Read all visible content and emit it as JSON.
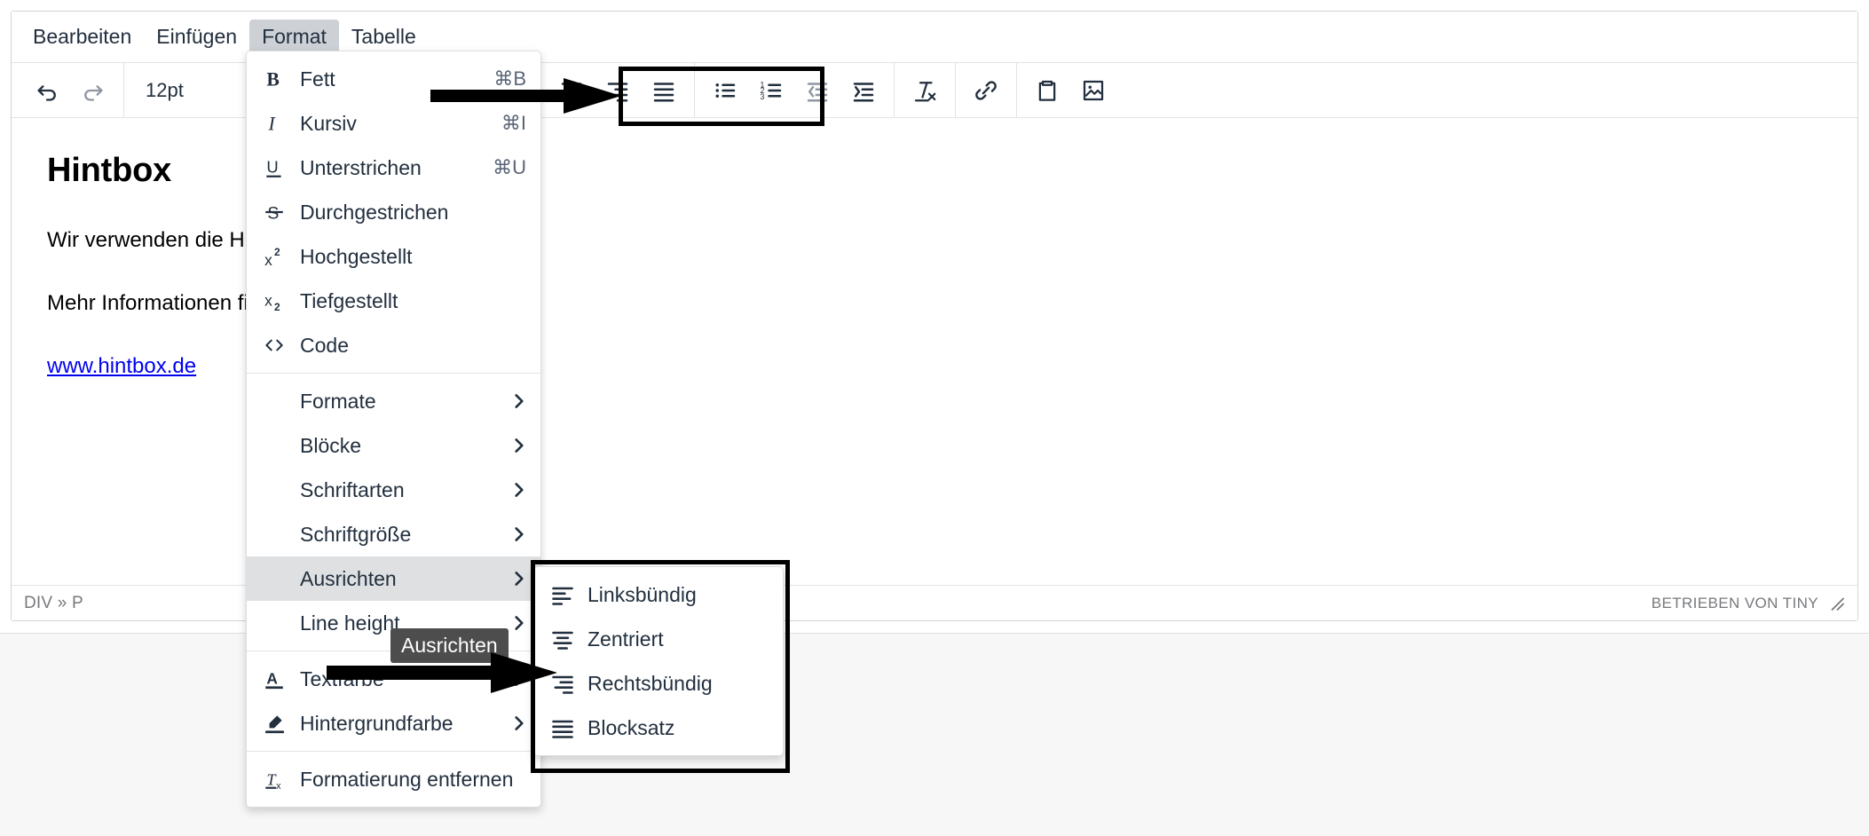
{
  "menubar": {
    "items": [
      {
        "label": "Bearbeiten",
        "active": false
      },
      {
        "label": "Einfügen",
        "active": false
      },
      {
        "label": "Format",
        "active": true
      },
      {
        "label": "Tabelle",
        "active": false
      }
    ]
  },
  "toolbar": {
    "undo_title": "Rückgängig",
    "redo_title": "Wiederholen",
    "fontsize_value": "12pt",
    "buttons": [
      {
        "name": "align-left-button",
        "title": "Linksbündig"
      },
      {
        "name": "align-center-button",
        "title": "Zentriert"
      },
      {
        "name": "align-right-button",
        "title": "Rechtsbündig"
      },
      {
        "name": "align-justify-button",
        "title": "Blocksatz"
      },
      {
        "name": "bullet-list-button",
        "title": "Aufzählung"
      },
      {
        "name": "numbered-list-button",
        "title": "Nummerierte Liste"
      },
      {
        "name": "outdent-button",
        "title": "Ausrücken"
      },
      {
        "name": "indent-button",
        "title": "Einrücken"
      },
      {
        "name": "clear-formatting-button",
        "title": "Formatierung entfernen"
      },
      {
        "name": "link-button",
        "title": "Link einfügen"
      },
      {
        "name": "paste-button",
        "title": "Einfügen"
      },
      {
        "name": "image-button",
        "title": "Bild einfügen"
      }
    ]
  },
  "document": {
    "heading": "Hintbox",
    "paragraph": "Wir verwenden die Hintbox als Ratgebersystem.",
    "link_intro": "Mehr Informationen finden Sie hier:",
    "link_text": "www.hintbox.de"
  },
  "statusbar": {
    "path": "DIV » P",
    "brand": "BETRIEBEN VON TINY"
  },
  "format_menu": {
    "items": [
      {
        "icon": "bold-icon",
        "label": "Fett",
        "shortcut": "⌘B",
        "caret": "",
        "active": false
      },
      {
        "icon": "italic-icon",
        "label": "Kursiv",
        "shortcut": "⌘I",
        "caret": "",
        "active": false
      },
      {
        "icon": "underline-icon",
        "label": "Unterstrichen",
        "shortcut": "⌘U",
        "caret": "",
        "active": false
      },
      {
        "icon": "strikethrough-icon",
        "label": "Durchgestrichen",
        "shortcut": "",
        "caret": "",
        "active": false
      },
      {
        "icon": "superscript-icon",
        "label": "Hochgestellt",
        "shortcut": "",
        "caret": "",
        "active": false
      },
      {
        "icon": "subscript-icon",
        "label": "Tiefgestellt",
        "shortcut": "",
        "caret": "",
        "active": false
      },
      {
        "icon": "code-icon",
        "label": "Code",
        "shortcut": "",
        "caret": "",
        "active": false
      },
      {
        "icon": "separator",
        "label": "",
        "shortcut": "",
        "caret": "",
        "active": false
      },
      {
        "icon": "none",
        "label": "Formate",
        "shortcut": "",
        "caret": "›",
        "active": false
      },
      {
        "icon": "none",
        "label": "Blöcke",
        "shortcut": "",
        "caret": "›",
        "active": false
      },
      {
        "icon": "none",
        "label": "Schriftarten",
        "shortcut": "",
        "caret": "›",
        "active": false
      },
      {
        "icon": "none",
        "label": "Schriftgröße",
        "shortcut": "",
        "caret": "›",
        "active": false
      },
      {
        "icon": "none",
        "label": "Ausrichten",
        "shortcut": "",
        "caret": "›",
        "active": true
      },
      {
        "icon": "none",
        "label": "Line height",
        "shortcut": "",
        "caret": "›",
        "active": false
      },
      {
        "icon": "separator",
        "label": "",
        "shortcut": "",
        "caret": "",
        "active": false
      },
      {
        "icon": "text-color-icon",
        "label": "Textfarbe",
        "shortcut": "",
        "caret": "›",
        "active": false
      },
      {
        "icon": "background-color-icon",
        "label": "Hintergrundfarbe",
        "shortcut": "",
        "caret": "›",
        "active": false
      },
      {
        "icon": "separator",
        "label": "",
        "shortcut": "",
        "caret": "",
        "active": false
      },
      {
        "icon": "clear-formatting-icon",
        "label": "Formatierung entfernen",
        "shortcut": "",
        "caret": "",
        "active": false
      }
    ]
  },
  "align_submenu": {
    "items": [
      {
        "icon": "align-left-icon",
        "label": "Linksbündig"
      },
      {
        "icon": "align-center-icon",
        "label": "Zentriert"
      },
      {
        "icon": "align-right-icon",
        "label": "Rechtsbündig"
      },
      {
        "icon": "align-justify-icon",
        "label": "Blocksatz"
      }
    ]
  },
  "tooltip": {
    "text": "Ausrichten"
  },
  "colors": {
    "menu_text": "#222f3e",
    "active_menu_bg": "#dee0e2",
    "link": "#0000ee",
    "tooltip_bg": "#4d4d4d",
    "annotation": "#000000",
    "muted_text": "#77797c"
  }
}
